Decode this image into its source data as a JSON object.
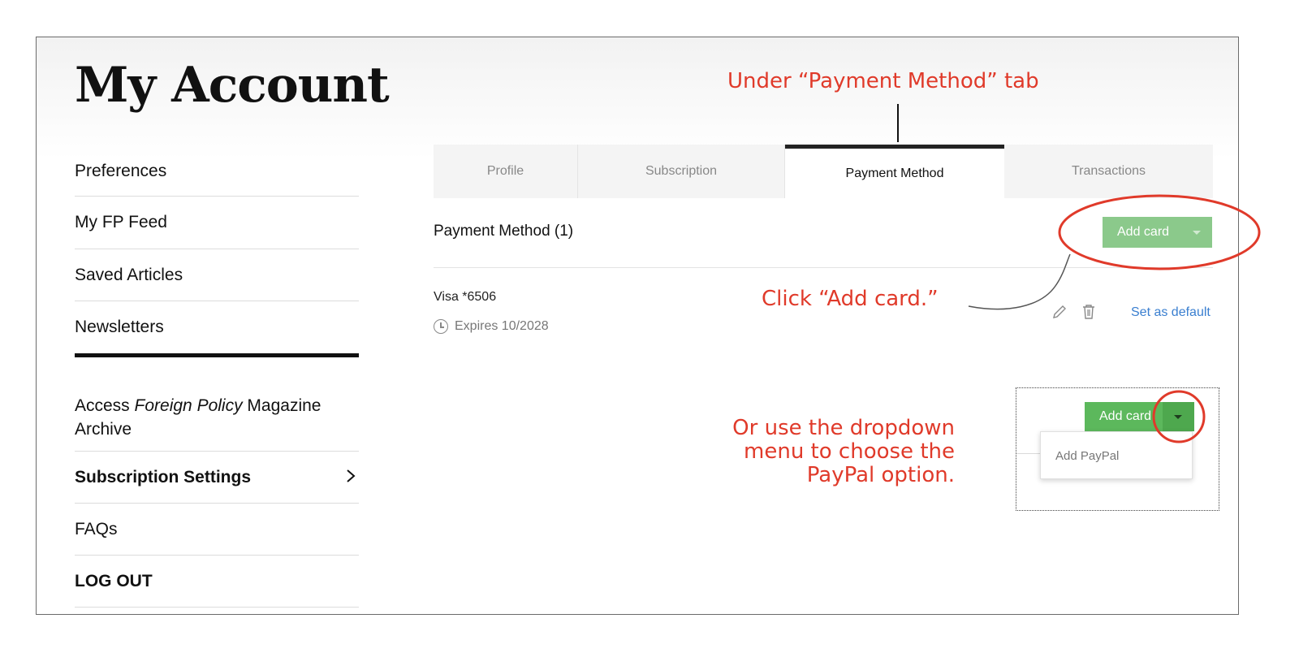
{
  "page": {
    "title": "My Account"
  },
  "sidebar": {
    "items": [
      {
        "label": "Preferences"
      },
      {
        "label": "My FP Feed"
      },
      {
        "label": "Saved Articles"
      },
      {
        "label": "Newsletters"
      },
      {
        "label_prefix": "Access ",
        "label_italic": "Foreign Policy",
        "label_suffix": " Magazine Archive"
      },
      {
        "label": "Subscription Settings",
        "icon": "chevron-right-icon"
      },
      {
        "label": "FAQs"
      },
      {
        "label": "LOG OUT"
      }
    ]
  },
  "tabs": [
    {
      "label": "Profile"
    },
    {
      "label": "Subscription"
    },
    {
      "label": "Payment Method",
      "active": true
    },
    {
      "label": "Transactions"
    }
  ],
  "payment": {
    "heading": "Payment Method (1)",
    "add_card_label": "Add card",
    "card": {
      "name": "Visa *6506",
      "expires": "Expires 10/2028",
      "set_default_label": "Set as default"
    }
  },
  "inset": {
    "add_card_label": "Add card",
    "dropdown_option": "Add PayPal"
  },
  "annotations": {
    "tab_note": "Under “Payment Method” tab",
    "click_note": "Click “Add card.”",
    "dropdown_note_lines": [
      "Or use the dropdown",
      "menu to choose the",
      "PayPal option."
    ]
  },
  "colors": {
    "annotation": "#e03a2a",
    "button_green": "#8bc98b",
    "inset_green": "#5cb85c",
    "link_blue": "#3a7fd0"
  }
}
